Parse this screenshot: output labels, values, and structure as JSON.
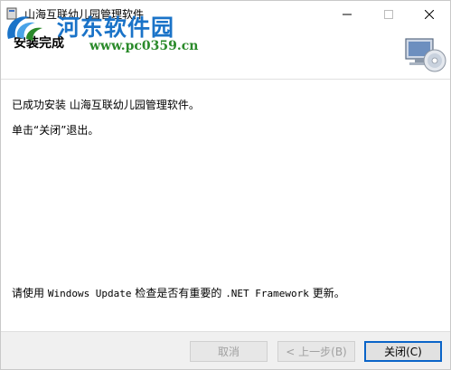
{
  "window": {
    "title": "山海互联幼儿园管理软件"
  },
  "watermark": {
    "site_name": "河东软件园",
    "url": "www.pc0359.cn"
  },
  "header": {
    "title": "安装完成"
  },
  "body": {
    "line1_prefix": "已成功安装 ",
    "line1_product": "山海互联幼儿园管理软件",
    "line1_suffix": "。",
    "line2": "单击“关闭”退出。",
    "note_p1": "请使用 ",
    "note_mono1": "Windows Update",
    "note_p2": " 检查是否有重要的 ",
    "note_mono2": ".NET Framework",
    "note_p3": " 更新。"
  },
  "buttons": {
    "cancel": "取消",
    "back": "< 上一步(B)",
    "close": "关闭(C)"
  },
  "colors": {
    "watermark_blue": "#1a73c8",
    "watermark_green": "#2a8a2a",
    "default_button_border": "#0a64c8"
  },
  "icons": {
    "title": "installer-app-icon",
    "header": "computer-disc-icon",
    "watermark": "pc0359-logo-icon"
  }
}
